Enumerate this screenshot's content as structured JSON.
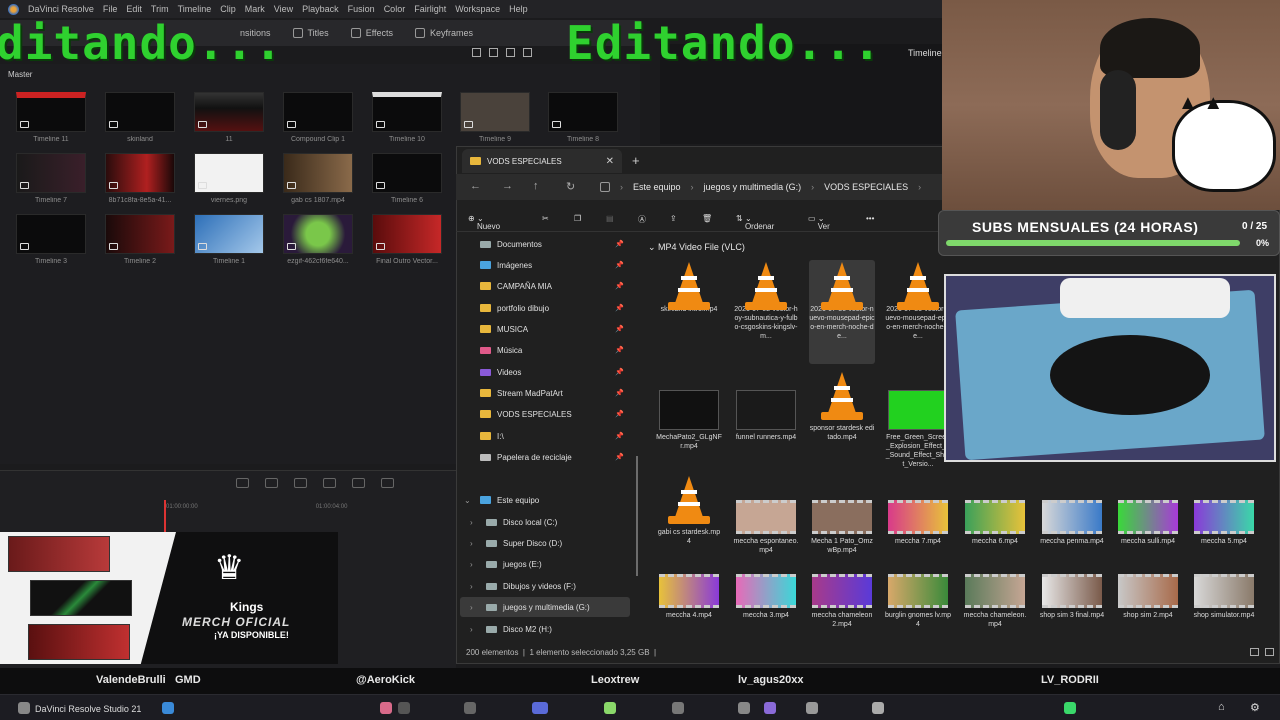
{
  "overlay": {
    "text_left": "ditando...",
    "text_right": "Editando..."
  },
  "resolve": {
    "app_name": "DaVinci Resolve",
    "menu": [
      "File",
      "Edit",
      "Trim",
      "Timeline",
      "Clip",
      "Mark",
      "View",
      "Playback",
      "Fusion",
      "Color",
      "Fairlight",
      "Workspace",
      "Help"
    ],
    "toolbar": {
      "transitions": "nsitions",
      "titles": "Titles",
      "effects": "Effects",
      "keyframes": "Keyframes"
    },
    "bin_name": "Master",
    "timeline_label": "Timeline",
    "clips": [
      "Timeline 11",
      "skinland",
      "11",
      "Compound Clip 1",
      "Timeline 10",
      "Timeline 9",
      "Timeline 8",
      "Timeline 7",
      "8b71c8fa-8e5a-41...",
      "viernes.png",
      "gab cs 1807.mp4",
      "Timeline 6",
      "Timeline 3",
      "Timeline 2",
      "Timeline 1",
      "ezgif-462cf6fe640...",
      "Final Outro Vector..."
    ],
    "ruler": {
      "t1": "01:00:00:00",
      "t2": "01:00:04:00"
    }
  },
  "merch": {
    "brand": "Kings",
    "title": "MERCH OFICIAL",
    "subtitle": "¡YA DISPONIBLE!"
  },
  "explorer": {
    "tab_title": "VODS ESPECIALES",
    "breadcrumb": [
      "Este equipo",
      "juegos y multimedia (G:)",
      "VODS ESPECIALES"
    ],
    "commands": {
      "new": "Nuevo",
      "sort": "Ordenar",
      "view": "Ver"
    },
    "quick_access": [
      {
        "label": "Documentos"
      },
      {
        "label": "Imágenes"
      },
      {
        "label": "CAMPAÑA MIA"
      },
      {
        "label": "portfolio dibujo"
      },
      {
        "label": "MUSICA"
      },
      {
        "label": "Música"
      },
      {
        "label": "Videos"
      },
      {
        "label": "Stream MadPatArt"
      },
      {
        "label": "VODS ESPECIALES"
      },
      {
        "label": "I:\\"
      },
      {
        "label": "Papelera de reciclaje"
      }
    ],
    "this_pc": "Este equipo",
    "drives": [
      "Disco local (C:)",
      "Super Disco (D:)",
      "juegos (E:)",
      "Dibujos y videos (F:)",
      "juegos y multimedia (G:)",
      "Disco M2 (H:)"
    ],
    "group_header": "MP4 Video File (VLC)",
    "files_row1": [
      "skinland intro.mp4",
      "2026-07-02-vector-hoy-subnautica-y-fulbo-csgoskins-kingslv-m...",
      "2026-07-30-vector-nuevo-mousepad-epico-en-merch-noche-de...",
      "2026-07-30-vector-nuevo-mousepad-epico-en-merch-noche-de..."
    ],
    "files_row2": [
      "MechaPato2_GLgNFr.mp4",
      "funnel runners.mp4",
      "sponsor stardesk editado.mp4",
      "Free_Green_Screen_Explosion_Effect_+_Sound_Effect_Short_Versio..."
    ],
    "files_row3": [
      "gabi cs stardesk.mp4",
      "meccha espontaneo.mp4",
      "Mecha 1 Pato_OmzwBp.mp4",
      "meccha 7.mp4",
      "meccha 6.mp4",
      "meccha penma.mp4",
      "meccha sulli.mp4",
      "meccha 5.mp4"
    ],
    "files_row4": [
      "meccha 4.mp4",
      "meccha 3.mp4",
      "meccha chameleon 2.mp4",
      "burglin gnomes lv.mp4",
      "meccha chameleon.mp4",
      "shop sim 3 final.mp4",
      "shop sim 2.mp4",
      "shop simulator.mp4"
    ],
    "status": {
      "count": "200 elementos",
      "selected": "1 elemento seleccionado  3,25 GB"
    }
  },
  "subs": {
    "title": "SUBS MENSUALES (24 HORAS)",
    "count": "0 / 25",
    "percent": "0%",
    "progress": 0
  },
  "names": [
    "ValendeBrulli",
    "GMD",
    "@AeroKick",
    "Leoxtrew",
    "lv_agus20xx",
    "LV_RODRII"
  ],
  "taskbar": {
    "app_label": "DaVinci Resolve Studio 21"
  }
}
